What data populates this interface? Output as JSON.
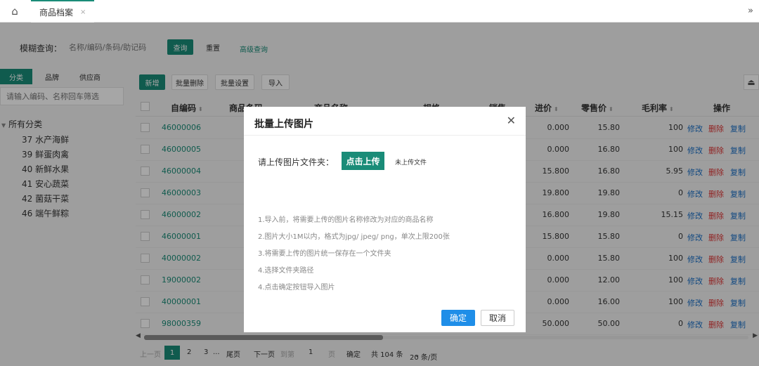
{
  "tabbar": {
    "tab_label": "商品档案",
    "tab_close": "×",
    "more": "»"
  },
  "search": {
    "label": "模糊查询：",
    "placeholder": "名称/编码/条码/助记码",
    "query_btn": "查询",
    "reset_btn": "重置",
    "advanced_link": "高级查询"
  },
  "left": {
    "tabs": [
      "分类",
      "品牌",
      "供应商"
    ],
    "filter_placeholder": "请输入编码、名称回车筛选",
    "tree_root": "所有分类",
    "tree_items": [
      "37 水产海鲜",
      "39 鲜蛋肉禽",
      "40 新鲜水果",
      "41 安心蔬菜",
      "42 菌菇干菜",
      "46 端午鲜粽"
    ]
  },
  "toolbar": {
    "add": "新增",
    "batch_delete": "批量删除",
    "batch_settings": "批量设置",
    "import": "导入"
  },
  "table": {
    "headers": {
      "code": "自编码",
      "barcode": "商品条码",
      "name": "商品名称",
      "spec": "规格",
      "sales": "销售",
      "purchase": "进价",
      "retail": "零售价",
      "margin": "毛利率",
      "ops": "操作"
    },
    "op_labels": {
      "edit": "修改",
      "delete": "删除",
      "copy": "复制"
    },
    "rows": [
      {
        "code": "46000006",
        "purchase": "0.000",
        "retail": "15.80",
        "margin": "100"
      },
      {
        "code": "46000005",
        "purchase": "0.000",
        "retail": "16.80",
        "margin": "100"
      },
      {
        "code": "46000004",
        "purchase": "15.800",
        "retail": "16.80",
        "margin": "5.95"
      },
      {
        "code": "46000003",
        "purchase": "19.800",
        "retail": "19.80",
        "margin": "0"
      },
      {
        "code": "46000002",
        "purchase": "16.800",
        "retail": "19.80",
        "margin": "15.15"
      },
      {
        "code": "46000001",
        "purchase": "15.800",
        "retail": "15.80",
        "margin": "0"
      },
      {
        "code": "40000002",
        "purchase": "0.000",
        "retail": "15.80",
        "margin": "100"
      },
      {
        "code": "19000002",
        "purchase": "0.000",
        "retail": "12.00",
        "margin": "100"
      },
      {
        "code": "40000001",
        "purchase": "0.000",
        "retail": "16.00",
        "margin": "100"
      },
      {
        "code": "98000359",
        "purchase": "50.000",
        "retail": "50.00",
        "margin": "0"
      }
    ]
  },
  "pager": {
    "prev": "上一页",
    "pages": [
      "1",
      "2",
      "3",
      "..."
    ],
    "last": "尾页",
    "next": "下一页",
    "goto_label": "到第",
    "goto_value": "1",
    "page_unit": "页",
    "confirm": "确定",
    "total": "共 104 条",
    "page_size": "20 条/页"
  },
  "modal": {
    "title": "批量上传图片",
    "upload_label": "请上传图片文件夹：",
    "upload_btn": "点击上传",
    "upload_status": "未上传文件",
    "instructions": [
      "1.导入前，将需要上传的图片名称修改为对应的商品名称",
      "2.图片大小1M以内，格式为jpg/ jpeg/ png，单次上限200张",
      "3.将需要上传的图片统一保存在一个文件夹",
      "4.选择文件夹路径",
      "4.点击确定按钮导入图片"
    ],
    "ok": "确定",
    "cancel": "取消"
  }
}
